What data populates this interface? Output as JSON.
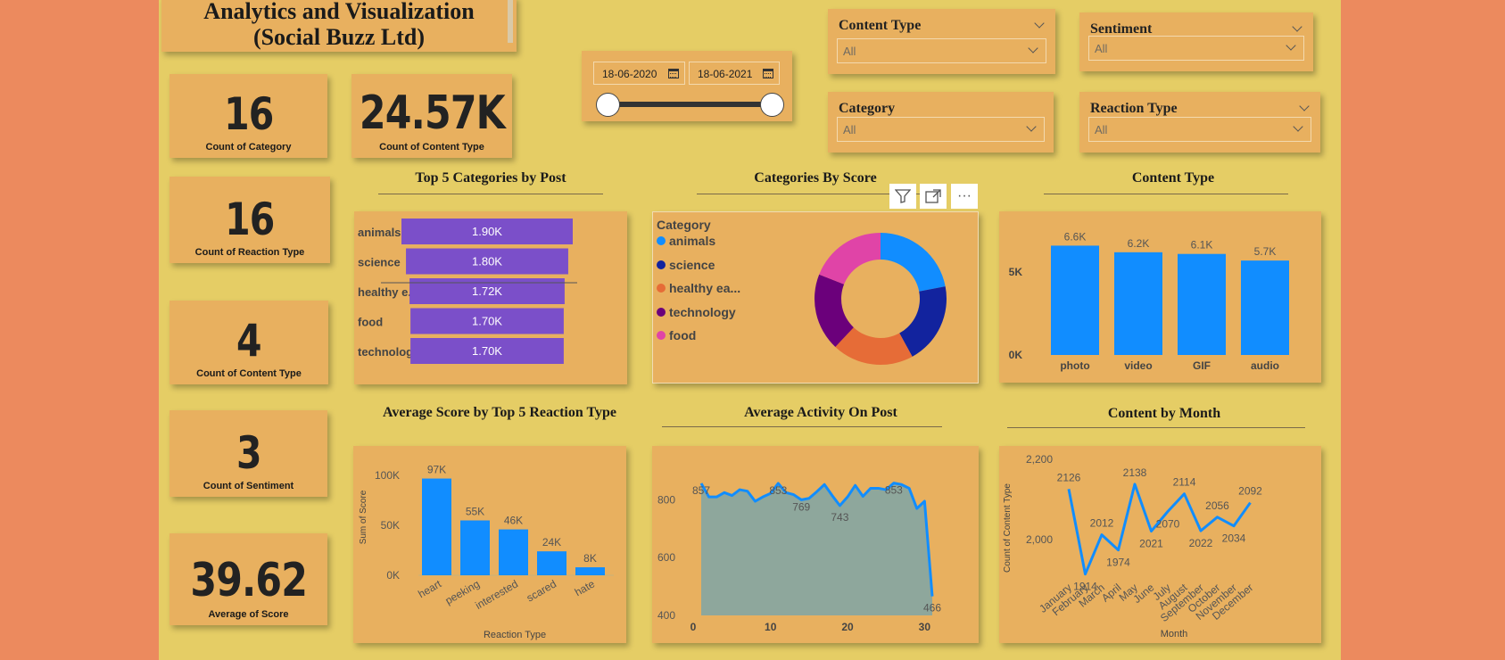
{
  "header": {
    "title_line1": "Analytics and Visualization",
    "title_line2": "(Social Buzz Ltd)"
  },
  "kpis": [
    {
      "value": "16",
      "label": "Count of Category"
    },
    {
      "value": "24.57K",
      "label": "Count of Content Type"
    },
    {
      "value": "16",
      "label": "Count of Reaction Type"
    },
    {
      "value": "4",
      "label": "Count of Content Type"
    },
    {
      "value": "3",
      "label": "Count of Sentiment"
    },
    {
      "value": "39.62",
      "label": "Average of Score"
    }
  ],
  "date_filter": {
    "start": "18-06-2020",
    "end": "18-06-2021"
  },
  "slicers": [
    {
      "title": "Content Type",
      "value": "All"
    },
    {
      "title": "Sentiment",
      "value": "All"
    },
    {
      "title": "Category",
      "value": "All"
    },
    {
      "title": "Reaction Type",
      "value": "All"
    }
  ],
  "toolbar": {
    "filter_icon": "filter-icon",
    "focus_icon": "focus-mode-icon",
    "more_label": "···"
  },
  "colors": {
    "background": "#ec8a5e",
    "canvas": "#e5cd65",
    "card": "#e8b05f",
    "bar_purple": "#7b4fc9",
    "bar_blue": "#118dff",
    "area_fill": "#8ea79c"
  },
  "chart_data": [
    {
      "id": "top5",
      "type": "bar",
      "orientation": "horizontal",
      "title": "Top 5 Categories by Post",
      "categories": [
        "animals",
        "science",
        "healthy e...",
        "food",
        "technology"
      ],
      "values": [
        1900,
        1800,
        1720,
        1700,
        1700
      ],
      "data_labels": [
        "1.90K",
        "1.80K",
        "1.72K",
        "1.70K",
        "1.70K"
      ]
    },
    {
      "id": "donut",
      "type": "pie",
      "title": "Categories By Score",
      "legend_title": "Category",
      "legend_position": "left",
      "series": [
        {
          "name": "animals",
          "value": 22,
          "color": "#118dff"
        },
        {
          "name": "science",
          "value": 20,
          "color": "#12239e"
        },
        {
          "name": "healthy ea...",
          "value": 20,
          "color": "#e66c37"
        },
        {
          "name": "technology",
          "value": 19,
          "color": "#6b007b"
        },
        {
          "name": "food",
          "value": 19,
          "color": "#e044a7"
        }
      ]
    },
    {
      "id": "content_type",
      "type": "bar",
      "title": "Content Type",
      "categories": [
        "photo",
        "video",
        "GIF",
        "audio"
      ],
      "values": [
        6600,
        6200,
        6100,
        5700
      ],
      "data_labels": [
        "6.6K",
        "6.2K",
        "6.1K",
        "5.7K"
      ],
      "ylim": [
        0,
        7000
      ],
      "yticks": [
        {
          "v": 5000,
          "label": "5K"
        },
        {
          "v": 0,
          "label": "0K"
        }
      ]
    },
    {
      "id": "reaction",
      "type": "bar",
      "title": "Average Score by Top 5 Reaction Type",
      "categories": [
        "heart",
        "peeking",
        "interested",
        "scared",
        "hate"
      ],
      "values": [
        97000,
        55000,
        46000,
        24000,
        8000
      ],
      "data_labels": [
        "97K",
        "55K",
        "46K",
        "24K",
        "8K"
      ],
      "xlabel": "Reaction Type",
      "ylabel": "Sum of Score",
      "ylim": [
        0,
        110000
      ],
      "yticks": [
        {
          "v": 100000,
          "label": "100K"
        },
        {
          "v": 50000,
          "label": "50K"
        },
        {
          "v": 0,
          "label": "0K"
        }
      ]
    },
    {
      "id": "activity",
      "type": "area",
      "title": "Average Activity On Post",
      "x": [
        1,
        2,
        3,
        4,
        5,
        6,
        7,
        8,
        9,
        10,
        11,
        12,
        13,
        14,
        15,
        16,
        17,
        18,
        19,
        20,
        21,
        22,
        23,
        24,
        25,
        26,
        27,
        28,
        29,
        30,
        31
      ],
      "y": [
        857,
        810,
        810,
        825,
        815,
        835,
        830,
        795,
        810,
        822,
        857,
        825,
        818,
        800,
        805,
        828,
        853,
        815,
        780,
        810,
        850,
        812,
        840,
        840,
        835,
        858,
        853,
        840,
        770,
        795,
        466
      ],
      "point_labels": [
        {
          "i": 0,
          "label": "857"
        },
        {
          "i": 10,
          "label": "853"
        },
        {
          "i": 13,
          "label": "769"
        },
        {
          "i": 18,
          "label": "743"
        },
        {
          "i": 25,
          "label": "853"
        },
        {
          "i": 30,
          "label": "466"
        }
      ],
      "ylim": [
        400,
        900
      ],
      "yticks": [
        {
          "v": 800,
          "label": "800"
        },
        {
          "v": 600,
          "label": "600"
        },
        {
          "v": 400,
          "label": "400"
        }
      ],
      "xticks": [
        {
          "v": 0,
          "label": "0"
        },
        {
          "v": 10,
          "label": "10"
        },
        {
          "v": 20,
          "label": "20"
        },
        {
          "v": 30,
          "label": "30"
        }
      ]
    },
    {
      "id": "month",
      "type": "line",
      "title": "Content by Month",
      "categories": [
        "January",
        "February",
        "March",
        "April",
        "May",
        "June",
        "July",
        "August",
        "September",
        "October",
        "November",
        "December"
      ],
      "values": [
        2126,
        1914,
        2012,
        1974,
        2138,
        2021,
        2070,
        2114,
        2022,
        2056,
        2034,
        2092
      ],
      "xlabel": "Month",
      "ylabel": "Count of Content Type",
      "ylim": [
        1900,
        2200
      ],
      "yticks": [
        {
          "v": 2200,
          "label": "2,200"
        },
        {
          "v": 2000,
          "label": "2,000"
        }
      ]
    }
  ]
}
